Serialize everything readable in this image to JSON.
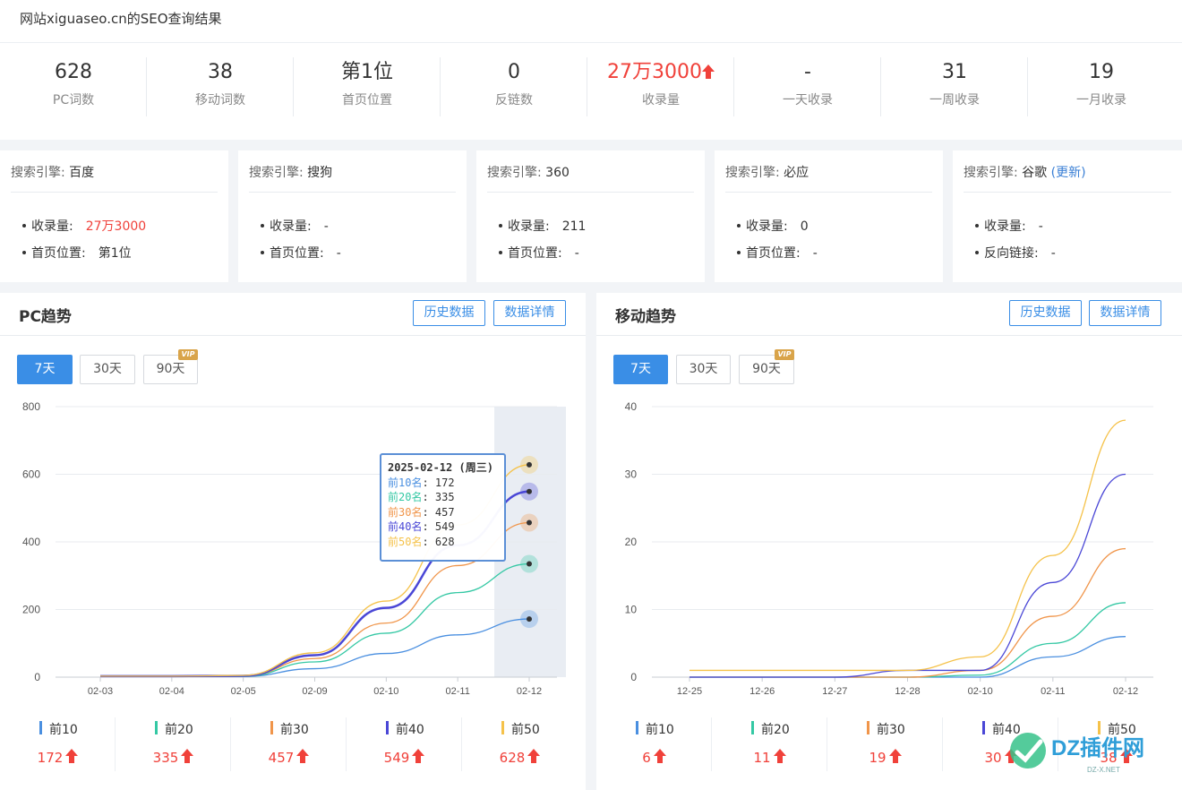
{
  "page_title": "网站xiguaseo.cn的SEO查询结果",
  "stats": [
    {
      "value": "628",
      "label": "PC词数",
      "red": false,
      "arrow": false
    },
    {
      "value": "38",
      "label": "移动词数",
      "red": false,
      "arrow": false
    },
    {
      "value": "第1位",
      "label": "首页位置",
      "red": false,
      "arrow": false
    },
    {
      "value": "0",
      "label": "反链数",
      "red": false,
      "arrow": false
    },
    {
      "value": "27万3000",
      "label": "收录量",
      "red": true,
      "arrow": true
    },
    {
      "value": "-",
      "label": "一天收录",
      "red": false,
      "arrow": false
    },
    {
      "value": "31",
      "label": "一周收录",
      "red": false,
      "arrow": false
    },
    {
      "value": "19",
      "label": "一月收录",
      "red": false,
      "arrow": false
    }
  ],
  "engines": [
    {
      "prefix": "搜索引擎:",
      "name": "百度",
      "update": "",
      "rows": [
        {
          "label": "收录量:",
          "value": "27万3000",
          "red": true
        },
        {
          "label": "首页位置:",
          "value": "第1位",
          "red": false
        }
      ]
    },
    {
      "prefix": "搜索引擎:",
      "name": "搜狗",
      "update": "",
      "rows": [
        {
          "label": "收录量:",
          "value": "-",
          "red": false
        },
        {
          "label": "首页位置:",
          "value": "-",
          "red": false
        }
      ]
    },
    {
      "prefix": "搜索引擎:",
      "name": "360",
      "update": "",
      "rows": [
        {
          "label": "收录量:",
          "value": "211",
          "red": false
        },
        {
          "label": "首页位置:",
          "value": "-",
          "red": false
        }
      ]
    },
    {
      "prefix": "搜索引擎:",
      "name": "必应",
      "update": "",
      "rows": [
        {
          "label": "收录量:",
          "value": "0",
          "red": false
        },
        {
          "label": "首页位置:",
          "value": "-",
          "red": false
        }
      ]
    },
    {
      "prefix": "搜索引擎:",
      "name": "谷歌",
      "update": "(更新)",
      "rows": [
        {
          "label": "收录量:",
          "value": "-",
          "red": false
        },
        {
          "label": "反向链接:",
          "value": "-",
          "red": false
        }
      ]
    }
  ],
  "panels": {
    "pc": {
      "title": "PC趋势",
      "btn_history": "历史数据",
      "btn_detail": "数据详情"
    },
    "mobile": {
      "title": "移动趋势",
      "btn_history": "历史数据",
      "btn_detail": "数据详情"
    }
  },
  "ranges": [
    "7天",
    "30天",
    "90天"
  ],
  "vip_label": "VIP",
  "colors": {
    "top10": "#4a8fe0",
    "top20": "#34c8a4",
    "top30": "#f0954a",
    "top40": "#4a47d6",
    "top50": "#f5c24a",
    "red": "#f0413a",
    "accent": "#3a8ee6"
  },
  "legend_pc": [
    {
      "name": "前10",
      "value": "172"
    },
    {
      "name": "前20",
      "value": "335"
    },
    {
      "name": "前30",
      "value": "457"
    },
    {
      "name": "前40",
      "value": "549"
    },
    {
      "name": "前50",
      "value": "628"
    }
  ],
  "legend_mobile": [
    {
      "name": "前10",
      "value": "6"
    },
    {
      "name": "前20",
      "value": "11"
    },
    {
      "name": "前30",
      "value": "19"
    },
    {
      "name": "前40",
      "value": "30"
    },
    {
      "name": "前50",
      "value": "38"
    }
  ],
  "tooltip": {
    "title": "2025-02-12 (周三)",
    "rows": [
      {
        "name": "前10名",
        "value": "172"
      },
      {
        "name": "前20名",
        "value": "335"
      },
      {
        "name": "前30名",
        "value": "457"
      },
      {
        "name": "前40名",
        "value": "549"
      },
      {
        "name": "前50名",
        "value": "628"
      }
    ]
  },
  "chart_data": [
    {
      "type": "line",
      "x": [
        "02-03",
        "02-04",
        "02-05",
        "02-09",
        "02-10",
        "02-11",
        "02-12"
      ],
      "ylim": [
        0,
        800
      ],
      "yticks": [
        0,
        200,
        400,
        600,
        800
      ],
      "series": [
        {
          "name": "前10",
          "values": [
            2,
            2,
            2,
            25,
            70,
            125,
            172
          ]
        },
        {
          "name": "前20",
          "values": [
            2,
            2,
            2,
            45,
            130,
            250,
            335
          ]
        },
        {
          "name": "前30",
          "values": [
            2,
            2,
            3,
            55,
            160,
            330,
            457
          ]
        },
        {
          "name": "前40",
          "values": [
            3,
            3,
            4,
            65,
            205,
            390,
            549
          ]
        },
        {
          "name": "前50",
          "values": [
            3,
            3,
            5,
            72,
            225,
            450,
            628
          ]
        }
      ]
    },
    {
      "type": "line",
      "x": [
        "12-25",
        "12-26",
        "12-27",
        "12-28",
        "02-10",
        "02-11",
        "02-12"
      ],
      "ylim": [
        0,
        40
      ],
      "yticks": [
        0,
        10,
        20,
        30,
        40
      ],
      "series": [
        {
          "name": "前10",
          "values": [
            0,
            0,
            0,
            0,
            0,
            3,
            6
          ]
        },
        {
          "name": "前20",
          "values": [
            0,
            0,
            0,
            0,
            0.3,
            5,
            11
          ]
        },
        {
          "name": "前30",
          "values": [
            0,
            0,
            0,
            0,
            1,
            9,
            19
          ]
        },
        {
          "name": "前40",
          "values": [
            0,
            0,
            0,
            1,
            1,
            14,
            30
          ]
        },
        {
          "name": "前50",
          "values": [
            1,
            1,
            1,
            1,
            3,
            18,
            38
          ]
        }
      ]
    }
  ],
  "watermark": {
    "brand": "DZ插件网",
    "sub": "DZ-X.NET"
  }
}
